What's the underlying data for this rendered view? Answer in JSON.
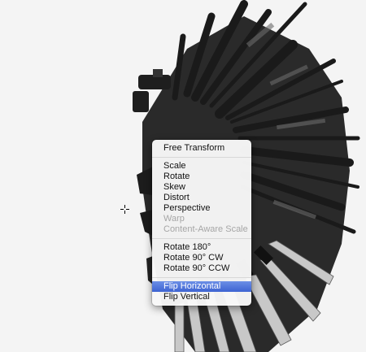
{
  "canvas": {
    "background": "#f4f4f4",
    "artwork": "radial-fan-of-firearms-and-blades"
  },
  "cursor": {
    "icon": "move-crosshair-icon"
  },
  "context_menu": {
    "items": [
      {
        "label": "Free Transform",
        "state": "enabled"
      },
      {
        "label": "Scale",
        "state": "enabled"
      },
      {
        "label": "Rotate",
        "state": "enabled"
      },
      {
        "label": "Skew",
        "state": "enabled"
      },
      {
        "label": "Distort",
        "state": "enabled"
      },
      {
        "label": "Perspective",
        "state": "enabled"
      },
      {
        "label": "Warp",
        "state": "disabled"
      },
      {
        "label": "Content-Aware Scale",
        "state": "disabled"
      },
      {
        "label": "Rotate 180°",
        "state": "enabled"
      },
      {
        "label": "Rotate 90° CW",
        "state": "enabled"
      },
      {
        "label": "Rotate 90° CCW",
        "state": "enabled"
      },
      {
        "label": "Flip Horizontal",
        "state": "selected"
      },
      {
        "label": "Flip Vertical",
        "state": "enabled"
      }
    ],
    "highlight_color": "#3d63d2"
  }
}
